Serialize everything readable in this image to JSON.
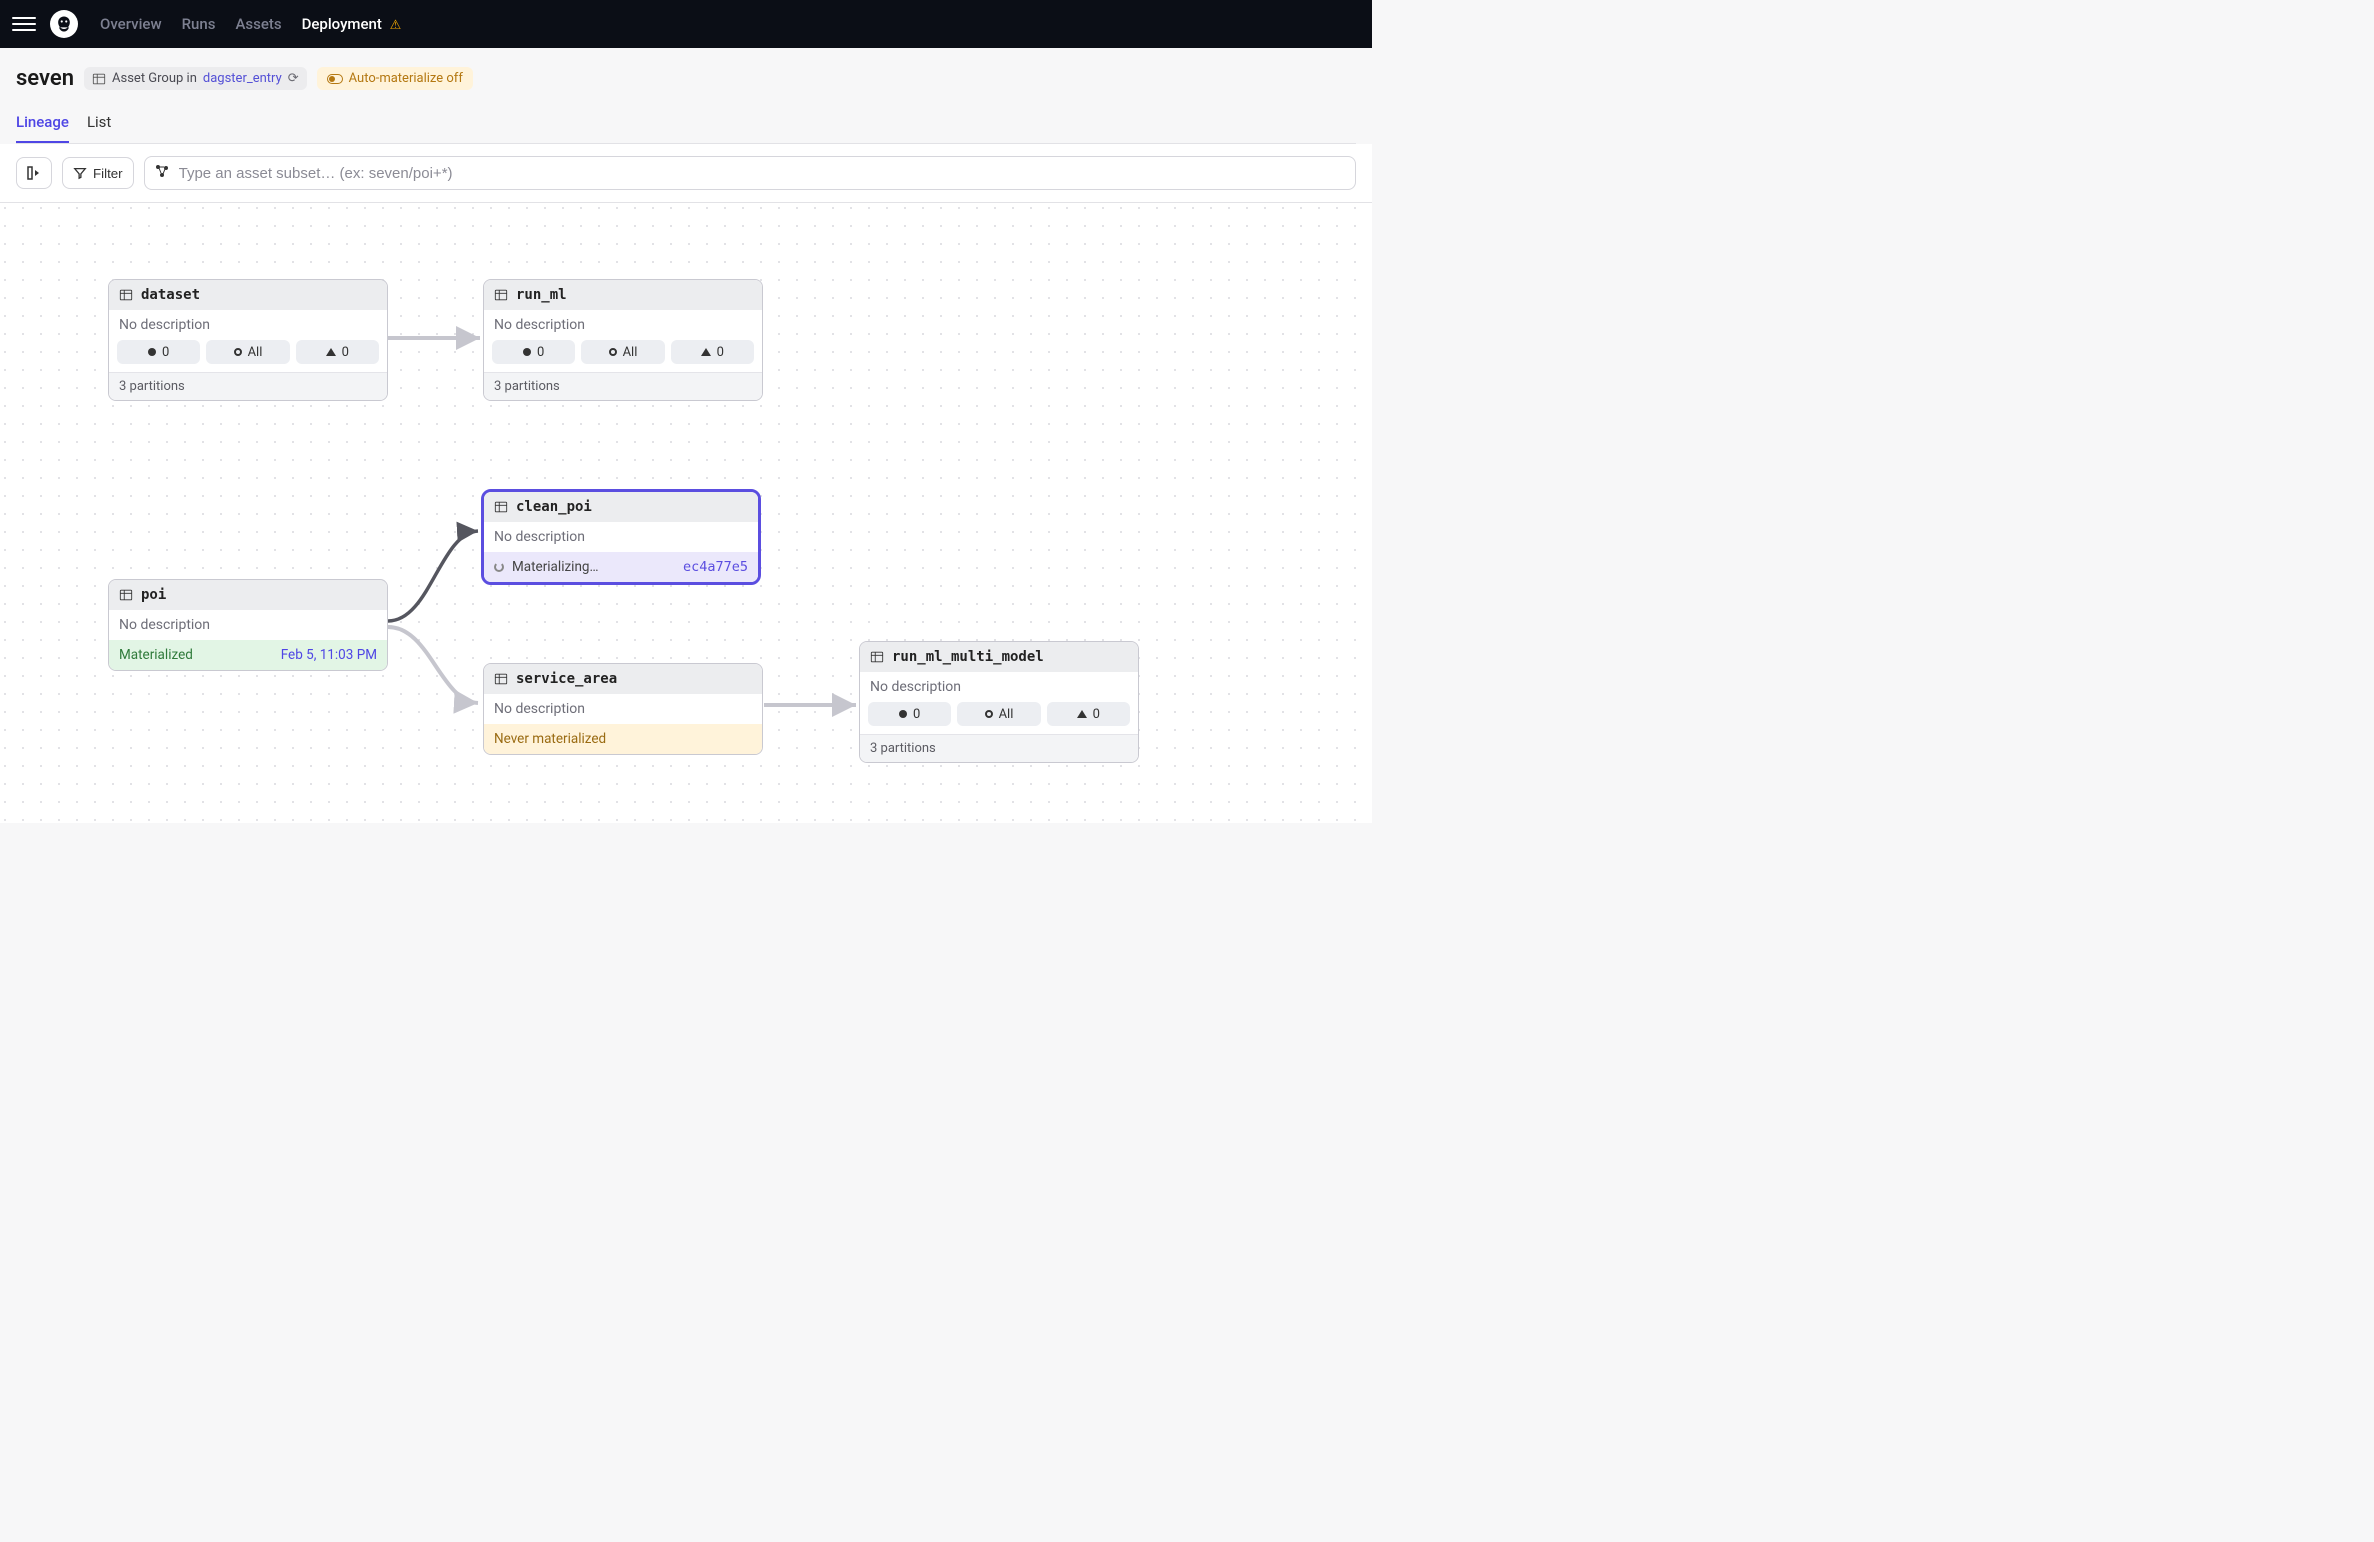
{
  "nav": {
    "items": [
      "Overview",
      "Runs",
      "Assets",
      "Deployment"
    ],
    "active": "Deployment"
  },
  "header": {
    "title": "seven",
    "group_chip_prefix": "Asset Group in",
    "group_chip_link": "dagster_entry",
    "automat_label": "Auto-materialize off"
  },
  "tabs": {
    "lineage": "Lineage",
    "list": "List",
    "active": "Lineage"
  },
  "toolbar": {
    "filter_label": "Filter",
    "search_placeholder": "Type an asset subset… (ex: seven/poi+*)"
  },
  "assets": {
    "dataset": {
      "name": "dataset",
      "desc": "No description",
      "pills": {
        "filled": "0",
        "open": "All",
        "tri": "0"
      },
      "partitions": "3 partitions"
    },
    "run_ml": {
      "name": "run_ml",
      "desc": "No description",
      "pills": {
        "filled": "0",
        "open": "All",
        "tri": "0"
      },
      "partitions": "3 partitions"
    },
    "poi": {
      "name": "poi",
      "desc": "No description",
      "status_label": "Materialized",
      "status_ts": "Feb 5, 11:03 PM"
    },
    "clean_poi": {
      "name": "clean_poi",
      "desc": "No description",
      "status_label": "Materializing…",
      "run_id": "ec4a77e5"
    },
    "service_area": {
      "name": "service_area",
      "desc": "No description",
      "status_label": "Never materialized"
    },
    "run_ml_multi_model": {
      "name": "run_ml_multi_model",
      "desc": "No description",
      "pills": {
        "filled": "0",
        "open": "All",
        "tri": "0"
      },
      "partitions": "3 partitions"
    }
  }
}
